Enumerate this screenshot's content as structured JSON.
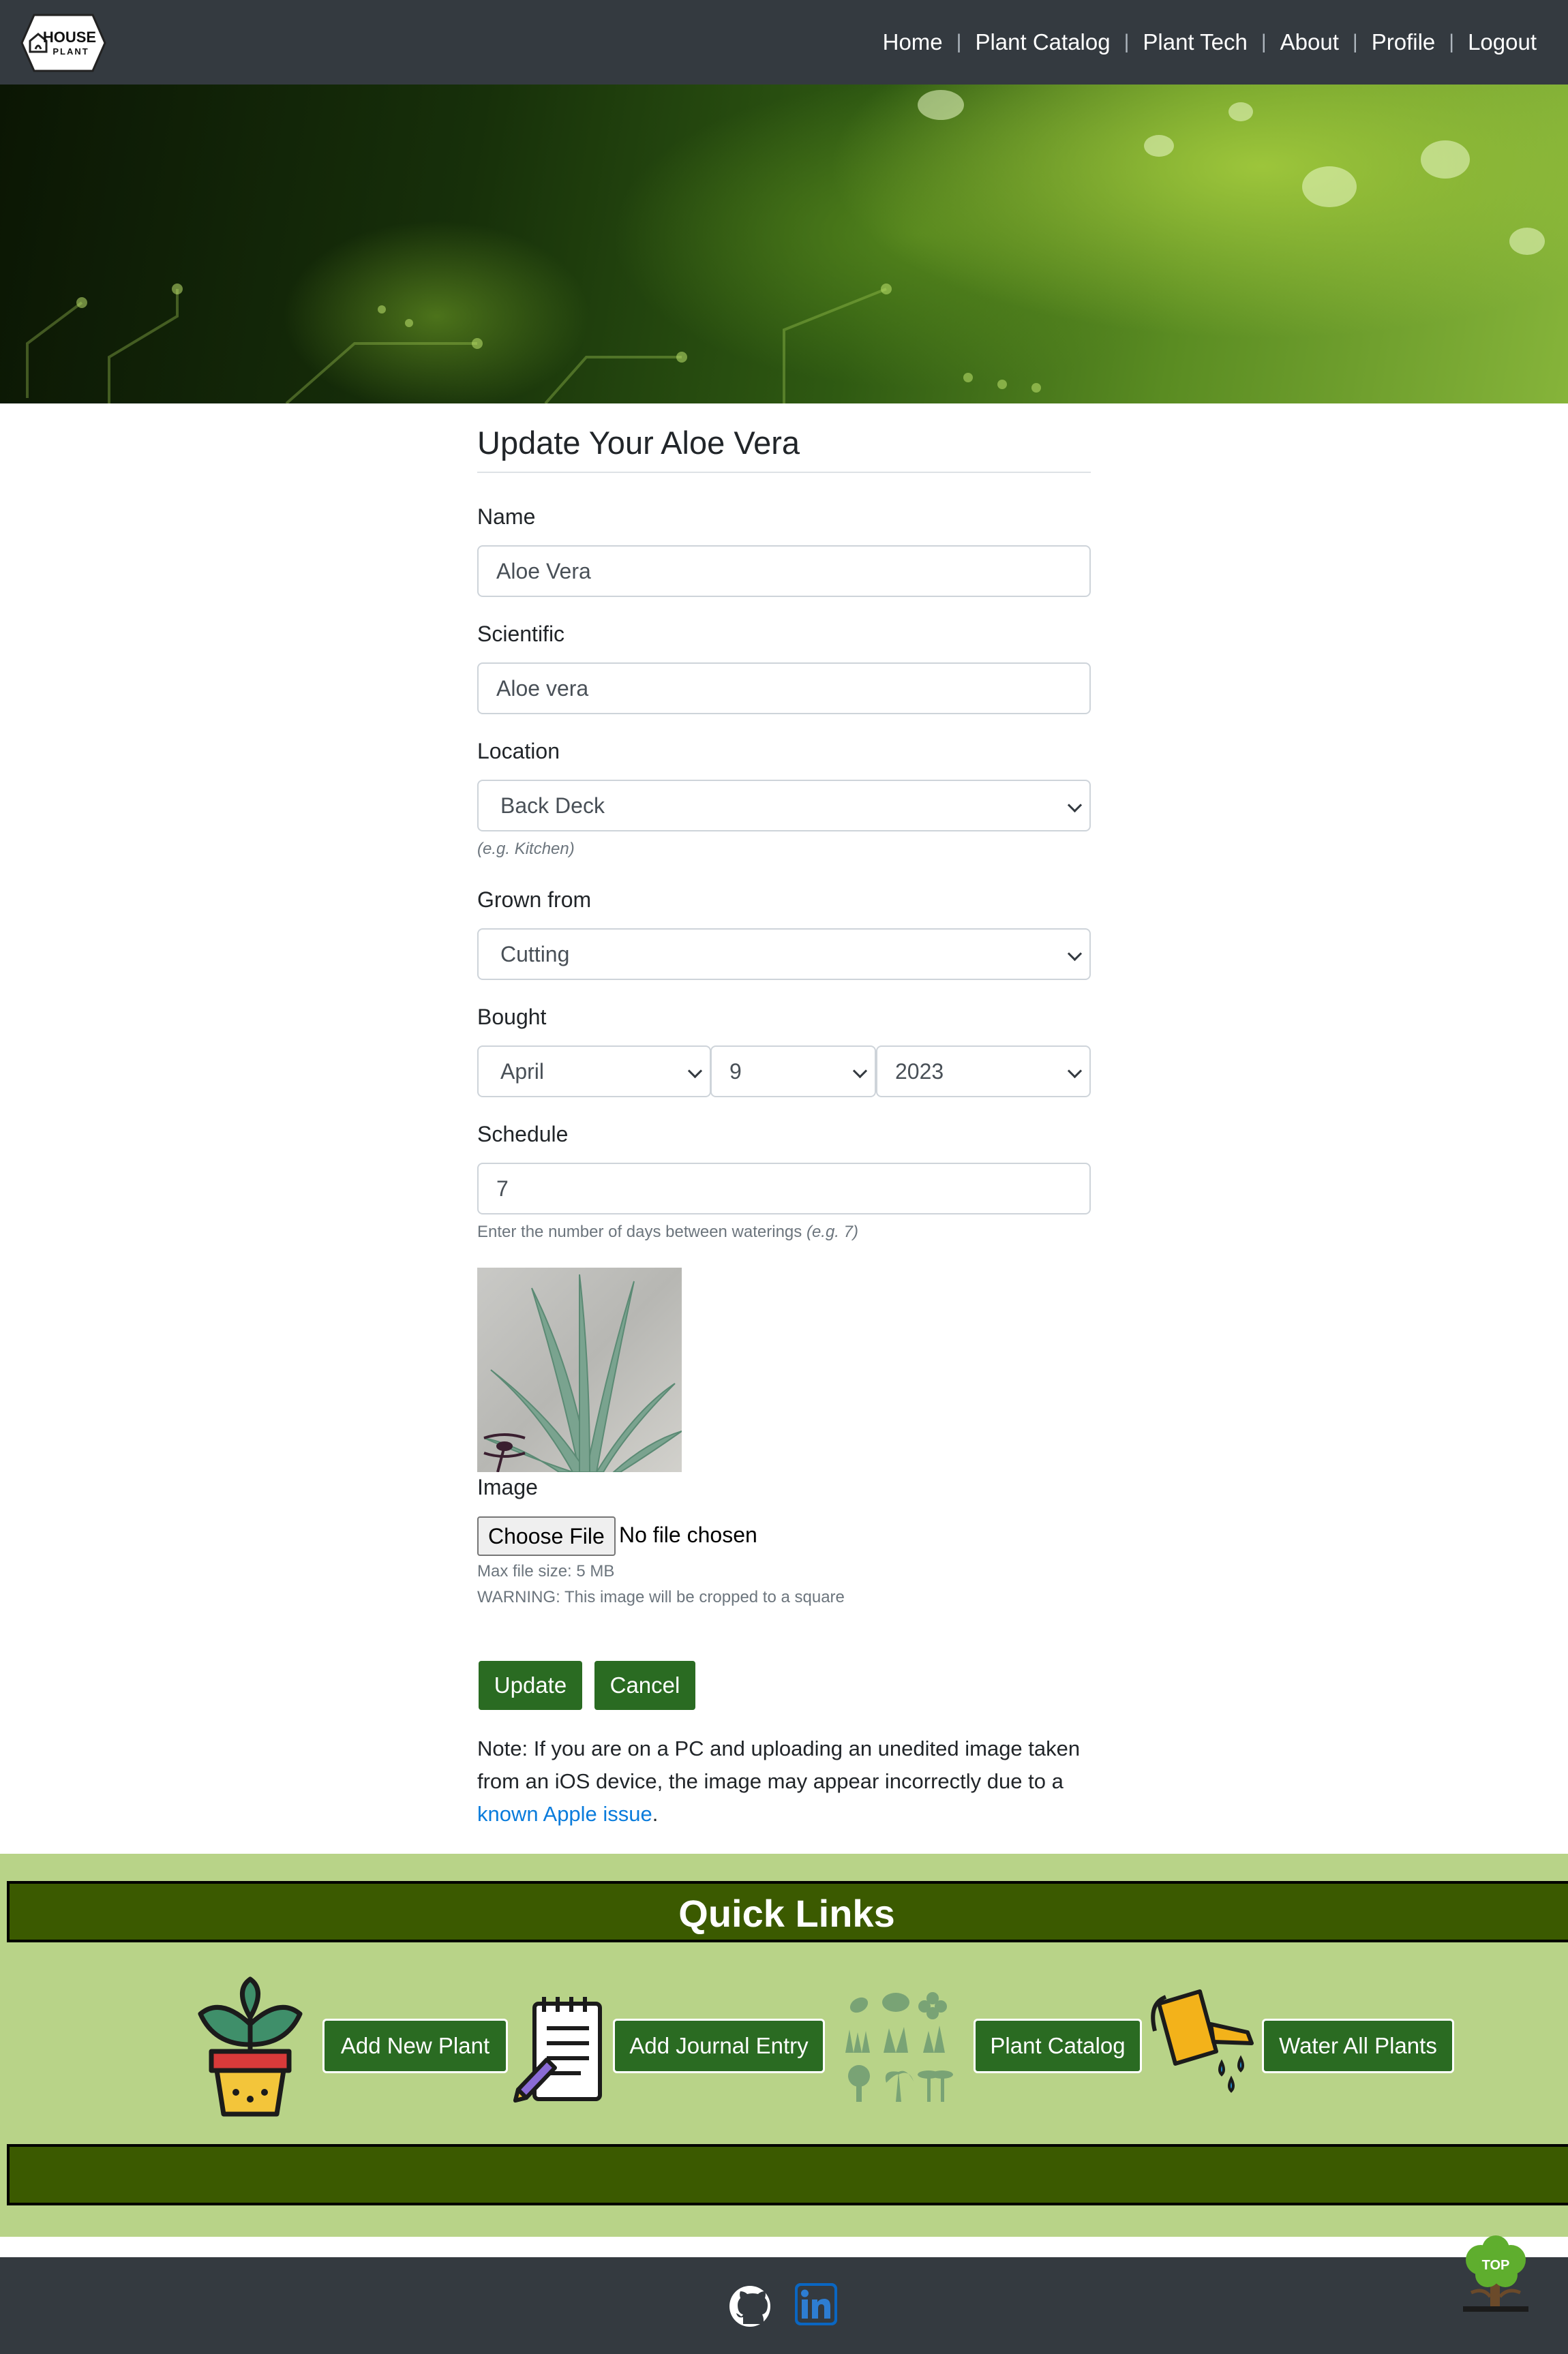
{
  "nav": {
    "logo_text_top": "HOUSE",
    "logo_text_bottom": "PLANT",
    "links": [
      "Home",
      "Plant Catalog",
      "Plant Tech",
      "About",
      "Profile",
      "Logout"
    ],
    "separator": "|"
  },
  "form": {
    "title": "Update Your Aloe Vera",
    "name_label": "Name",
    "name_value": "Aloe Vera",
    "scientific_label": "Scientific",
    "scientific_value": "Aloe vera",
    "location_label": "Location",
    "location_value": "Back Deck",
    "location_hint": "(e.g. Kitchen)",
    "grown_label": "Grown from",
    "grown_value": "Cutting",
    "bought_label": "Bought",
    "bought_month": "April",
    "bought_day": "9",
    "bought_year": "2023",
    "schedule_label": "Schedule",
    "schedule_value": "7",
    "schedule_hint": "Enter the number of days between waterings",
    "schedule_hint_example": "(e.g. 7)",
    "image_label": "Image",
    "choose_file": "Choose File",
    "file_status": "No file chosen",
    "max_size": "Max file size: 5 MB",
    "warning": "WARNING: This image will be cropped to a square",
    "update_button": "Update",
    "cancel_button": "Cancel",
    "note_prefix": "Note: If you are on a PC and uploading an unedited image taken from an iOS device, the image may appear incorrectly due to a ",
    "note_link": "known Apple issue",
    "note_suffix": "."
  },
  "quick_links": {
    "title": "Quick Links",
    "add_plant": "Add New Plant",
    "add_journal": "Add Journal Entry",
    "plant_catalog": "Plant Catalog",
    "water_all": "Water All Plants",
    "top_label": "TOP"
  },
  "colors": {
    "navbar": "#343a40",
    "primary_green": "#2a6b22",
    "quick_links_bg": "#b8d388",
    "quick_links_bar": "#3b5a00",
    "link": "#0a7cdc"
  },
  "icons": [
    "house-plant-logo",
    "potted-plant-icon",
    "notepad-icon",
    "plants-grid-icon",
    "watering-can-icon",
    "github-icon",
    "linkedin-icon",
    "tree-top-icon"
  ]
}
